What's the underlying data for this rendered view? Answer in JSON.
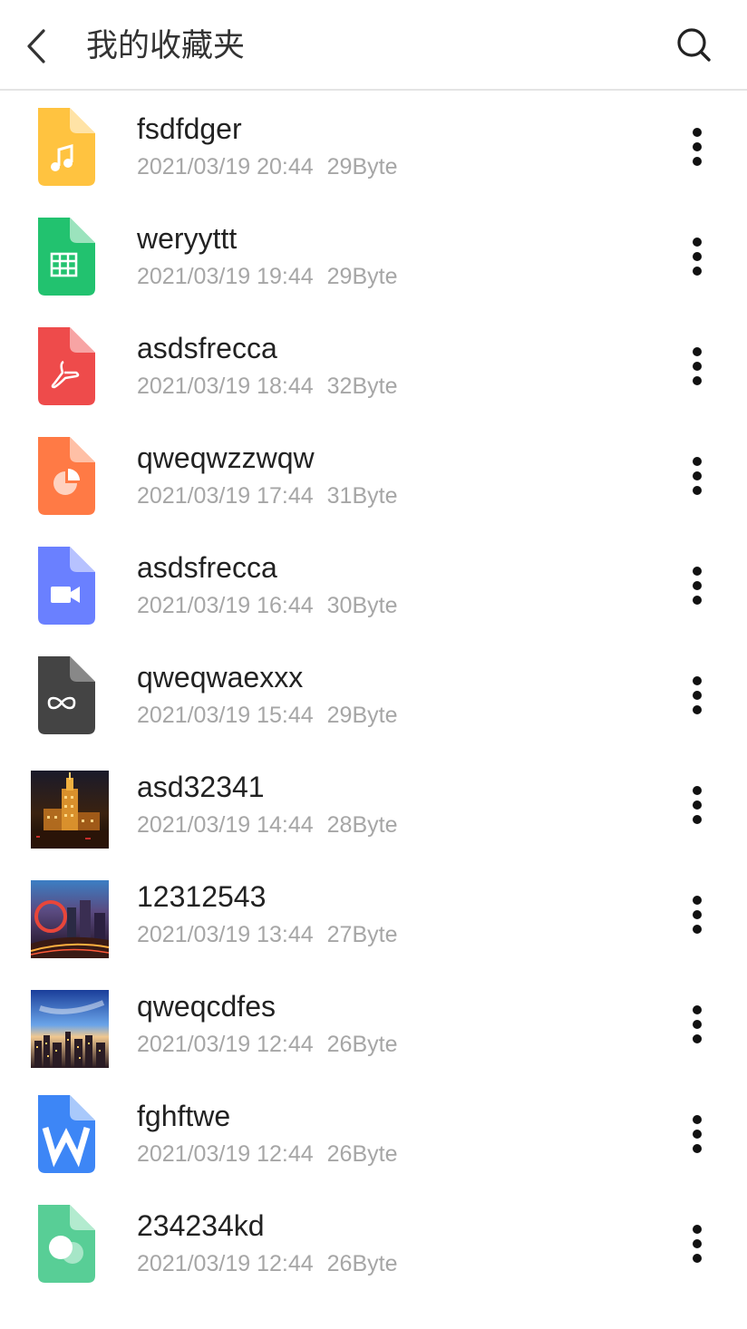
{
  "header": {
    "title": "我的收藏夹",
    "back_icon": "chevron-left-icon",
    "search_icon": "search-icon"
  },
  "files": [
    {
      "name": "fsdfdger",
      "date": "2021/03/19 20:44",
      "size": "29Byte",
      "kind": "music",
      "color": "#FFC340"
    },
    {
      "name": "weryyttt",
      "date": "2021/03/19 19:44",
      "size": "29Byte",
      "kind": "spreadsheet",
      "color": "#22C26F"
    },
    {
      "name": "asdsfrecca",
      "date": "2021/03/19 18:44",
      "size": "32Byte",
      "kind": "pdf",
      "color": "#EE4B4B"
    },
    {
      "name": "qweqwzzwqw",
      "date": "2021/03/19 17:44",
      "size": "31Byte",
      "kind": "presentation",
      "color": "#FF7A45"
    },
    {
      "name": "asdsfrecca",
      "date": "2021/03/19 16:44",
      "size": "30Byte",
      "kind": "video",
      "color": "#6A80FF"
    },
    {
      "name": "qweqwaexxx",
      "date": "2021/03/19 15:44",
      "size": "29Byte",
      "kind": "link",
      "color": "#444444"
    },
    {
      "name": "asd32341",
      "date": "2021/03/19 14:44",
      "size": "28Byte",
      "kind": "photo-night-building"
    },
    {
      "name": "12312543",
      "date": "2021/03/19 13:44",
      "size": "27Byte",
      "kind": "photo-city-lights"
    },
    {
      "name": "qweqcdfes",
      "date": "2021/03/19 12:44",
      "size": "26Byte",
      "kind": "photo-city-skyline"
    },
    {
      "name": "fghftwe",
      "date": "2021/03/19 12:44",
      "size": "26Byte",
      "kind": "word",
      "color": "#3D86F6"
    },
    {
      "name": "234234kd",
      "date": "2021/03/19 12:44",
      "size": "26Byte",
      "kind": "chat",
      "color": "#58CE96"
    }
  ],
  "more_icon": "more-vertical-icon"
}
